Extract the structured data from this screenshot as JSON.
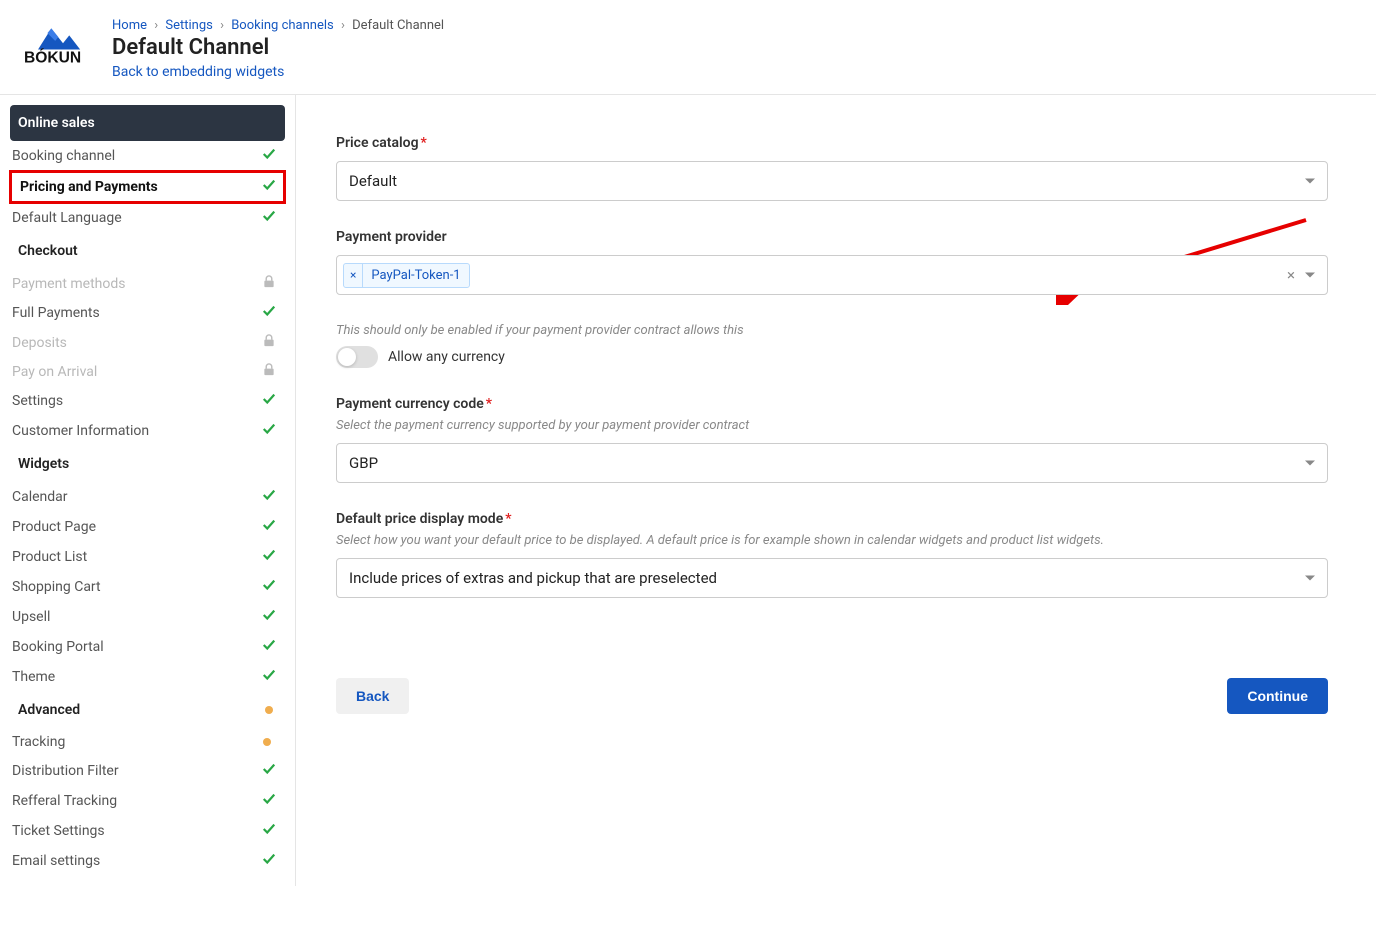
{
  "breadcrumb": {
    "home": "Home",
    "settings": "Settings",
    "booking_channels": "Booking channels",
    "current": "Default Channel"
  },
  "page_title": "Default Channel",
  "back_link": "Back to embedding widgets",
  "sidebar": {
    "sections": {
      "online_sales": "Online sales",
      "checkout": "Checkout",
      "widgets": "Widgets",
      "advanced": "Advanced"
    },
    "items": {
      "booking_channel": "Booking channel",
      "pricing_payments": "Pricing and Payments",
      "default_language": "Default Language",
      "payment_methods": "Payment methods",
      "full_payments": "Full Payments",
      "deposits": "Deposits",
      "pay_on_arrival": "Pay on Arrival",
      "settings": "Settings",
      "customer_info": "Customer Information",
      "calendar": "Calendar",
      "product_page": "Product Page",
      "product_list": "Product List",
      "shopping_cart": "Shopping Cart",
      "upsell": "Upsell",
      "booking_portal": "Booking Portal",
      "theme": "Theme",
      "tracking": "Tracking",
      "distribution_filter": "Distribution Filter",
      "refferal_tracking": "Refferal Tracking",
      "ticket_settings": "Ticket Settings",
      "email_settings": "Email settings"
    }
  },
  "form": {
    "price_catalog": {
      "label": "Price catalog",
      "value": "Default"
    },
    "payment_provider": {
      "label": "Payment provider",
      "tag": "PayPal-Token-1"
    },
    "allow_currency": {
      "note": "This should only be enabled if your payment provider contract allows this",
      "label": "Allow any currency"
    },
    "currency_code": {
      "label": "Payment currency code",
      "help": "Select the payment currency supported by your payment provider contract",
      "value": "GBP"
    },
    "display_mode": {
      "label": "Default price display mode",
      "help": "Select how you want your default price to be displayed. A default price is for example shown in calendar widgets and product list widgets.",
      "value": "Include prices of extras and pickup that are preselected"
    }
  },
  "buttons": {
    "back": "Back",
    "continue": "Continue"
  }
}
